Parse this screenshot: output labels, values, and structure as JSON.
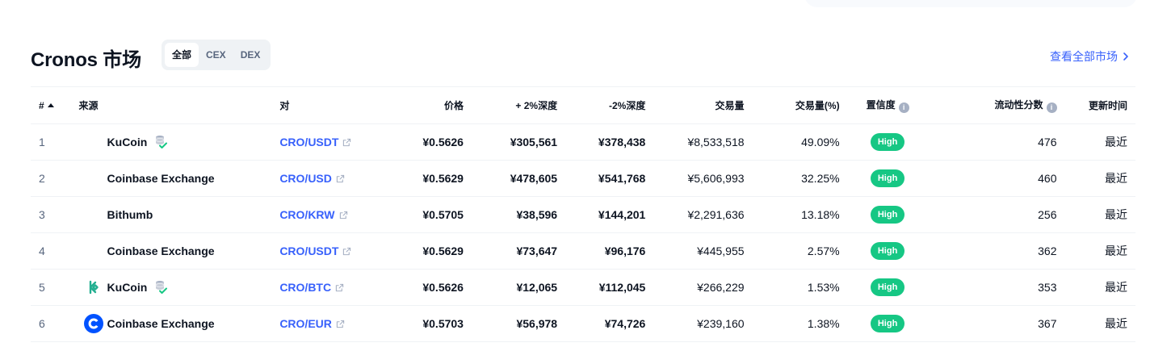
{
  "header": {
    "title": "Cronos 市场",
    "filters": [
      "全部",
      "CEX",
      "DEX"
    ],
    "active_filter": "全部",
    "view_all": "查看全部市场"
  },
  "columns": {
    "rank": "#",
    "source": "来源",
    "pair": "对",
    "price": "价格",
    "depth_plus": "+ 2%深度",
    "depth_minus": "-2%深度",
    "volume": "交易量",
    "volume_pct": "交易量(%)",
    "confidence": "置信度",
    "liquidity": "流动性分数",
    "updated": "更新时间"
  },
  "rows": [
    {
      "rank": "1",
      "source": "KuCoin",
      "logo": "none",
      "verified": true,
      "pair": "CRO/USDT",
      "price": "¥0.5626",
      "depth_plus": "¥305,561",
      "depth_minus": "¥378,438",
      "volume": "¥8,533,518",
      "volume_pct": "49.09%",
      "confidence": "High",
      "liquidity": "476",
      "updated": "最近"
    },
    {
      "rank": "2",
      "source": "Coinbase Exchange",
      "logo": "none",
      "verified": false,
      "pair": "CRO/USD",
      "price": "¥0.5629",
      "depth_plus": "¥478,605",
      "depth_minus": "¥541,768",
      "volume": "¥5,606,993",
      "volume_pct": "32.25%",
      "confidence": "High",
      "liquidity": "460",
      "updated": "最近"
    },
    {
      "rank": "3",
      "source": "Bithumb",
      "logo": "none",
      "verified": false,
      "pair": "CRO/KRW",
      "price": "¥0.5705",
      "depth_plus": "¥38,596",
      "depth_minus": "¥144,201",
      "volume": "¥2,291,636",
      "volume_pct": "13.18%",
      "confidence": "High",
      "liquidity": "256",
      "updated": "最近"
    },
    {
      "rank": "4",
      "source": "Coinbase Exchange",
      "logo": "none",
      "verified": false,
      "pair": "CRO/USDT",
      "price": "¥0.5629",
      "depth_plus": "¥73,647",
      "depth_minus": "¥96,176",
      "volume": "¥445,955",
      "volume_pct": "2.57%",
      "confidence": "High",
      "liquidity": "362",
      "updated": "最近"
    },
    {
      "rank": "5",
      "source": "KuCoin",
      "logo": "kucoin",
      "verified": true,
      "pair": "CRO/BTC",
      "price": "¥0.5626",
      "depth_plus": "¥12,065",
      "depth_minus": "¥112,045",
      "volume": "¥266,229",
      "volume_pct": "1.53%",
      "confidence": "High",
      "liquidity": "353",
      "updated": "最近"
    },
    {
      "rank": "6",
      "source": "Coinbase Exchange",
      "logo": "coinbase",
      "verified": false,
      "pair": "CRO/EUR",
      "price": "¥0.5703",
      "depth_plus": "¥56,978",
      "depth_minus": "¥74,726",
      "volume": "¥239,160",
      "volume_pct": "1.38%",
      "confidence": "High",
      "liquidity": "367",
      "updated": "最近"
    }
  ],
  "colors": {
    "accent": "#3861fb",
    "high_badge": "#16c784",
    "text": "#0d1421",
    "muted": "#58667e"
  }
}
